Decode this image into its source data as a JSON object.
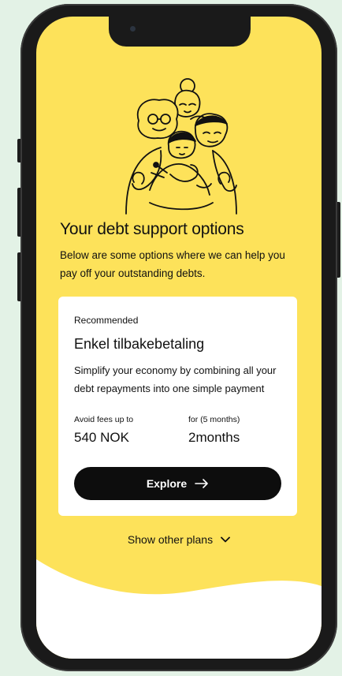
{
  "onboarding": {
    "title": "Your debt support options",
    "subtitle": "Below are some options where we can help you pay off your outstanding debts."
  },
  "plan_card": {
    "badge": "Recommended",
    "title": "Enkel tilbakebetaling",
    "description": "Simplify your economy by combining all your debt repayments into one simple payment",
    "fees_label": "Avoid fees up to",
    "fees_value": "540 NOK",
    "duration_label": "for  (5 months)",
    "duration_value": "2months",
    "cta_label": "Explore"
  },
  "other_plans": {
    "label": "Show other plans"
  },
  "colors": {
    "background": "#e3f2e6",
    "screen_yellow": "#fde25a",
    "button_black": "#0d0d0d",
    "card_white": "#ffffff"
  },
  "icons": {
    "cta": "arrow-right-icon",
    "toggle": "chevron-down-icon"
  }
}
